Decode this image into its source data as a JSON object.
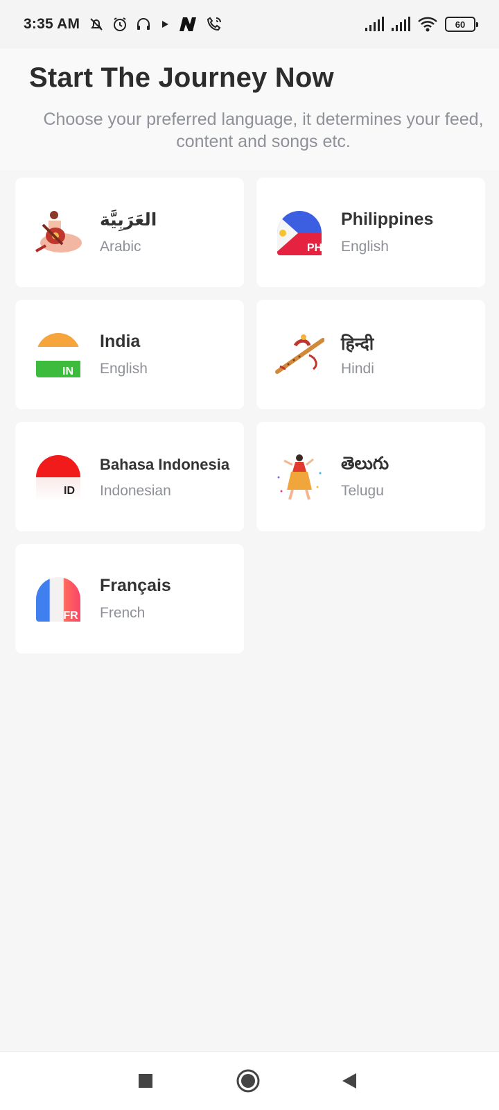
{
  "status_bar": {
    "time": "3:35 AM",
    "battery": "60",
    "icons": [
      "muted-bell-icon",
      "alarm-icon",
      "headset-icon",
      "play-icon",
      "n-app-icon",
      "wifi-call-icon",
      "signal-icon",
      "signal-icon",
      "wifi-icon",
      "battery-icon"
    ]
  },
  "header": {
    "title": "Start The Journey Now",
    "subtitle": "Choose your preferred language, it determines your feed, content and songs etc."
  },
  "languages": [
    {
      "name": "العَرَبِيَّة",
      "sub": "Arabic",
      "icon": "oud-player-icon"
    },
    {
      "name": "Philippines",
      "sub": "English",
      "icon": "philippines-flag-icon",
      "badge": "PH"
    },
    {
      "name": "India",
      "sub": "English",
      "icon": "india-flag-icon",
      "badge": "IN"
    },
    {
      "name": "हिन्दी",
      "sub": "Hindi",
      "icon": "flute-icon"
    },
    {
      "name": "Bahasa Indonesia",
      "sub": "Indonesian",
      "icon": "indonesia-flag-icon",
      "badge": "ID"
    },
    {
      "name": "తెలుగు",
      "sub": "Telugu",
      "icon": "dancer-icon"
    },
    {
      "name": "Français",
      "sub": "French",
      "icon": "france-flag-icon",
      "badge": "FR"
    }
  ],
  "nav_bar": {
    "icons": [
      "recents-square-icon",
      "home-circle-icon",
      "back-triangle-icon"
    ]
  },
  "colors": {
    "background": "#f6f6f7",
    "card": "#ffffff",
    "title": "#2d2d2d",
    "subtitle": "#8e9198"
  }
}
